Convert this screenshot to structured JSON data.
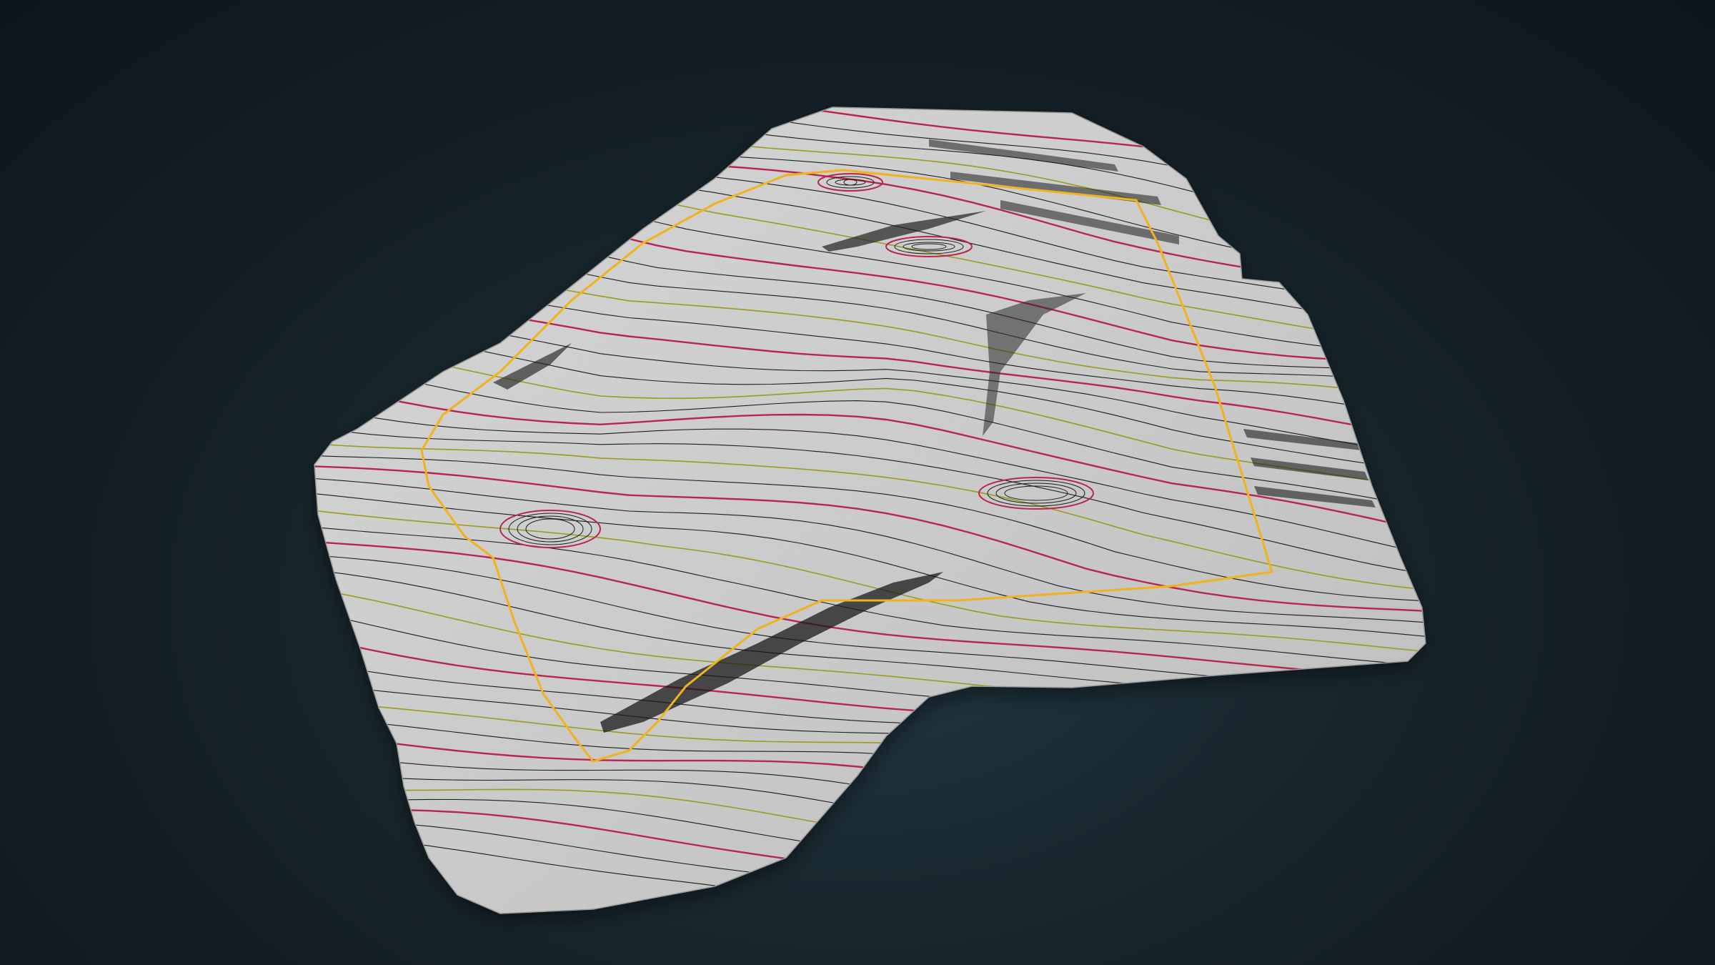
{
  "map": {
    "type": "3d-terrain-contour",
    "background_color": "#15232b",
    "terrain_color": "#cfcfcf",
    "boundary_color": "#f2b21c",
    "contour_styles": {
      "minor": "#1c1c1c",
      "index": "#b8264f",
      "intermediate": "#9a9a1c"
    },
    "contour_count": 48,
    "features": [
      "terraced-pit",
      "escarpment",
      "site-boundary"
    ]
  }
}
